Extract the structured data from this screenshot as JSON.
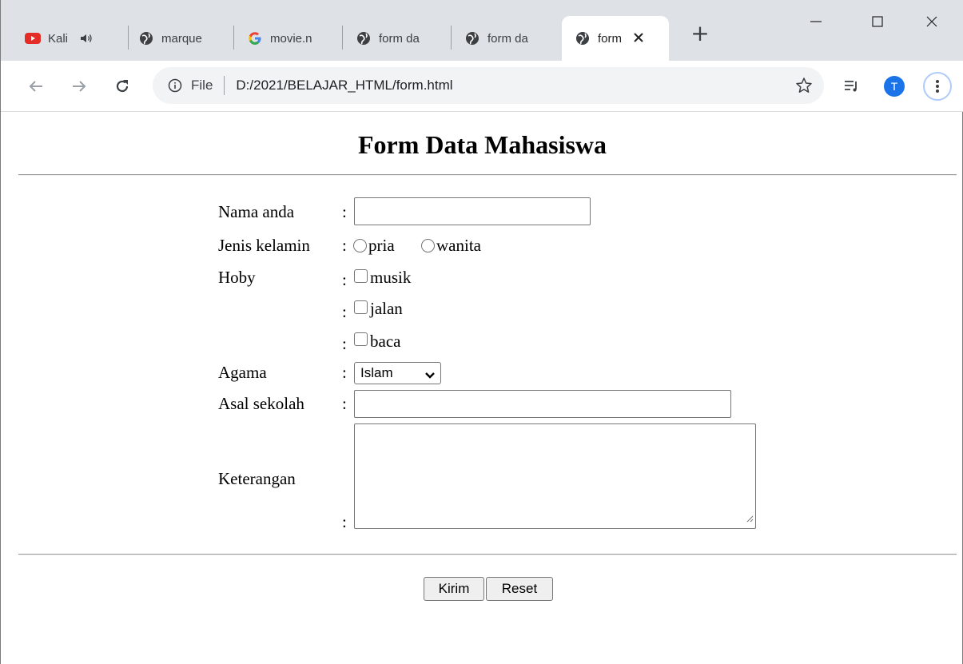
{
  "browser": {
    "tabs": [
      {
        "title": "Kali",
        "favicon": "youtube-icon",
        "audio": true
      },
      {
        "title": "marque",
        "favicon": "globe-icon"
      },
      {
        "title": "movie.n",
        "favicon": "google-icon"
      },
      {
        "title": "form da",
        "favicon": "globe-icon"
      },
      {
        "title": "form da",
        "favicon": "globe-icon"
      },
      {
        "title": "form",
        "favicon": "globe-icon",
        "active": true
      }
    ],
    "new_tab_label": "+",
    "omnibox": {
      "scheme": "File",
      "url": "D:/2021/BELAJAR_HTML/form.html"
    },
    "avatar_initial": "T",
    "colors": {
      "tabstrip": "#dee1e6",
      "accent": "#1a73e8"
    }
  },
  "form": {
    "title": "Form Data Mahasiswa",
    "colon": ":",
    "fields": {
      "nama": {
        "label": "Nama anda",
        "value": ""
      },
      "jenis_kelamin": {
        "label": "Jenis kelamin",
        "options": [
          "pria",
          "wanita"
        ]
      },
      "hoby": {
        "label": "Hoby",
        "options": [
          "musik",
          "jalan",
          "baca"
        ]
      },
      "agama": {
        "label": "Agama",
        "selected": "Islam"
      },
      "asal_sekolah": {
        "label": "Asal sekolah",
        "value": ""
      },
      "keterangan": {
        "label": "Keterangan",
        "value": ""
      }
    },
    "buttons": {
      "submit": "Kirim",
      "reset": "Reset"
    }
  }
}
